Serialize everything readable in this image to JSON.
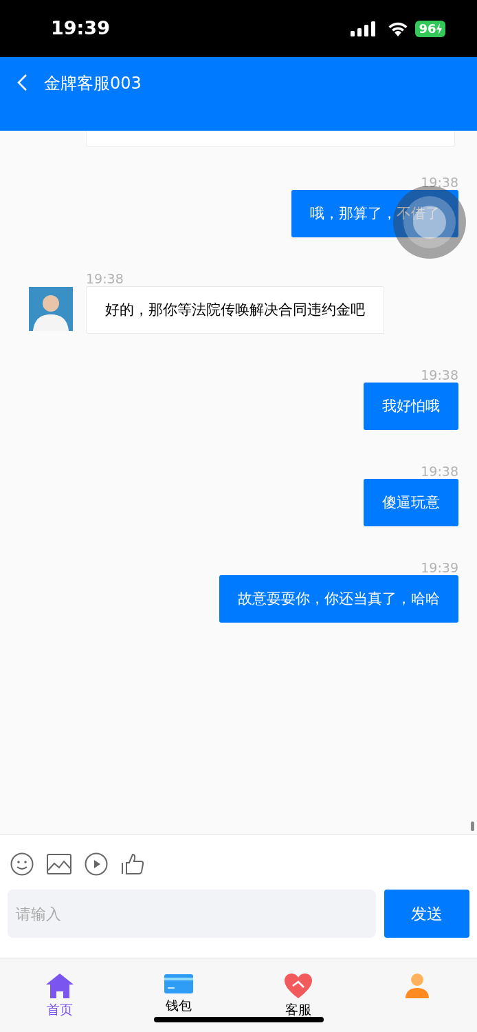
{
  "status_bar": {
    "time": "19:39",
    "battery": "96"
  },
  "header": {
    "title": "金牌客服003"
  },
  "messages": [
    {
      "kind": "sent",
      "time": "19:38",
      "text": "哦，那算了，不借了"
    },
    {
      "kind": "received",
      "time": "19:38",
      "text": "好的，那你等法院传唤解决合同违约金吧"
    },
    {
      "kind": "sent",
      "time": "19:38",
      "text": "我好怕哦"
    },
    {
      "kind": "sent",
      "time": "19:38",
      "text": "傻逼玩意"
    },
    {
      "kind": "sent",
      "time": "19:39",
      "text": "故意耍耍你，你还当真了，哈哈"
    }
  ],
  "composer": {
    "placeholder": "请输入",
    "send": "发送"
  },
  "tab_bar": [
    {
      "kind": "home",
      "label": "首页",
      "selected": true
    },
    {
      "kind": "wallet",
      "label": "钱包",
      "selected": false
    },
    {
      "kind": "service",
      "label": "客服",
      "selected": false
    },
    {
      "kind": "profile",
      "selected": false
    }
  ]
}
